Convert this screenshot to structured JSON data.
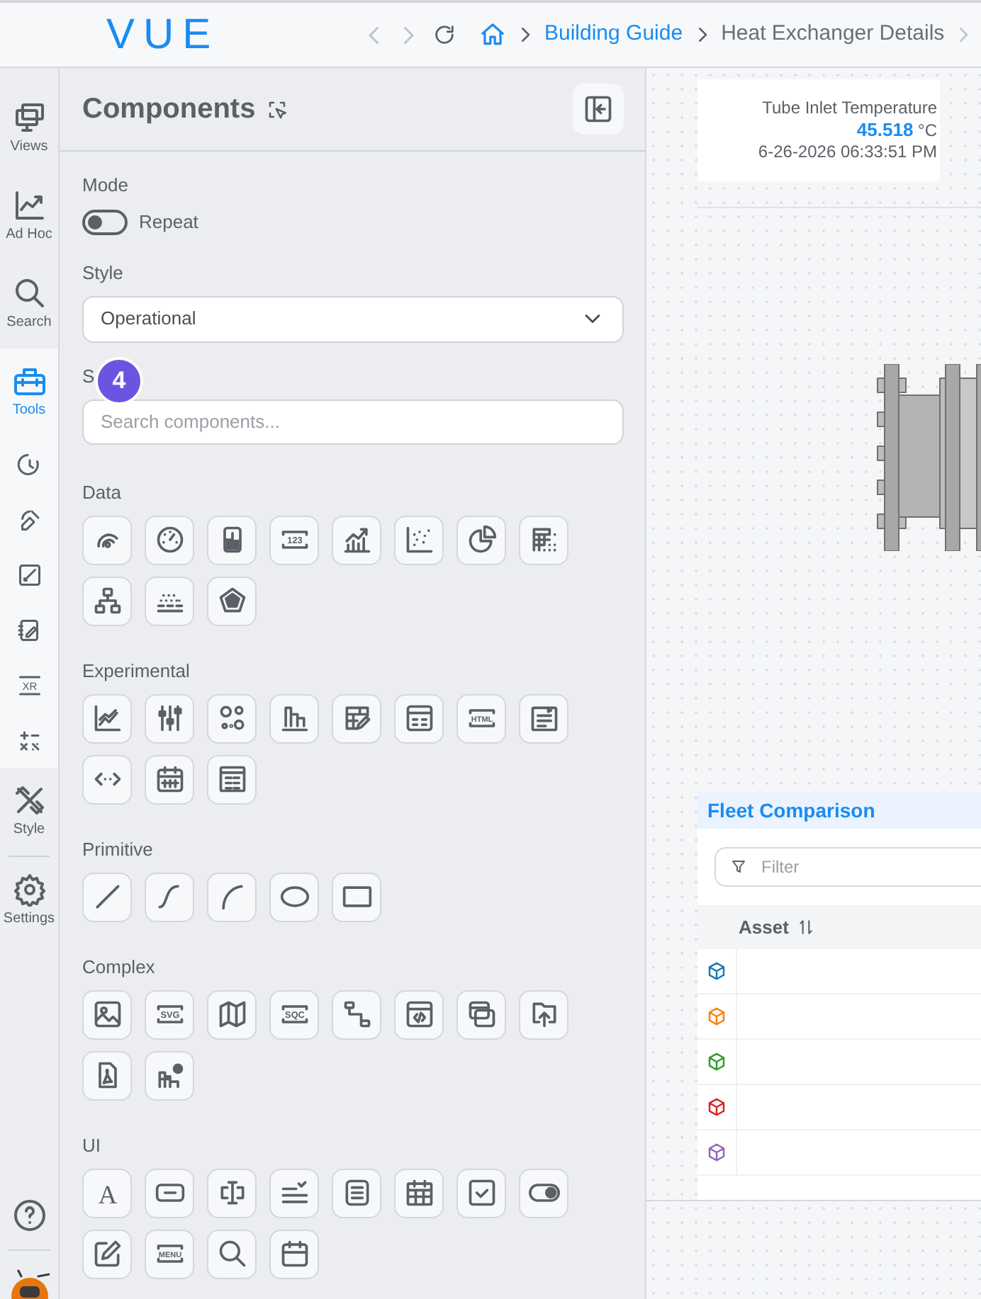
{
  "header": {
    "logo": "VUE",
    "breadcrumbs": [
      {
        "label": "Building Guide",
        "kind": "link"
      },
      {
        "label": "Heat Exchanger Details",
        "kind": "current"
      }
    ]
  },
  "nav": {
    "items": [
      {
        "kind": "views",
        "label": "Views",
        "selected": false
      },
      {
        "kind": "adhoc",
        "label": "Ad Hoc",
        "selected": false
      },
      {
        "kind": "search",
        "label": "Search",
        "selected": false
      },
      {
        "kind": "tools",
        "label": "Tools",
        "selected": true,
        "children": [
          {
            "kind": "timer"
          },
          {
            "kind": "pen"
          },
          {
            "kind": "image-edit"
          },
          {
            "kind": "notebook"
          },
          {
            "kind": "xr",
            "label": "XR"
          },
          {
            "kind": "math"
          }
        ]
      },
      {
        "kind": "style",
        "label": "Style",
        "selected": false
      },
      {
        "kind": "settings",
        "label": "Settings",
        "selected": false
      }
    ]
  },
  "panel": {
    "title": "Components",
    "mode": {
      "label": "Mode",
      "toggle_label": "Repeat",
      "on": false
    },
    "style": {
      "label": "Style",
      "value": "Operational"
    },
    "search": {
      "label": "S",
      "badge": "4",
      "placeholder": "Search components..."
    },
    "sections": [
      {
        "title": "Data",
        "tiles": [
          {
            "kind": "arcs"
          },
          {
            "kind": "gauge"
          },
          {
            "kind": "tank"
          },
          {
            "kind": "tag",
            "label": "123"
          },
          {
            "kind": "line-bars"
          },
          {
            "kind": "scatter"
          },
          {
            "kind": "pie"
          },
          {
            "kind": "grid"
          },
          {
            "kind": "hierarchy"
          },
          {
            "kind": "dotted-lines"
          },
          {
            "kind": "pentagon"
          }
        ]
      },
      {
        "title": "Experimental",
        "tiles": [
          {
            "kind": "area-chart"
          },
          {
            "kind": "sliders"
          },
          {
            "kind": "circles"
          },
          {
            "kind": "bar-chart"
          },
          {
            "kind": "table-pen"
          },
          {
            "kind": "form-window"
          },
          {
            "kind": "tag",
            "label": "HTML"
          },
          {
            "kind": "document"
          },
          {
            "kind": "code-arrows"
          },
          {
            "kind": "calendar-grid"
          },
          {
            "kind": "spreadsheet"
          }
        ]
      },
      {
        "title": "Primitive",
        "tiles": [
          {
            "kind": "line"
          },
          {
            "kind": "s-curve"
          },
          {
            "kind": "arc"
          },
          {
            "kind": "ellipse"
          },
          {
            "kind": "rectangle"
          }
        ]
      },
      {
        "title": "Complex",
        "tiles": [
          {
            "kind": "image"
          },
          {
            "kind": "tag",
            "label": "SVG"
          },
          {
            "kind": "map"
          },
          {
            "kind": "tag",
            "label": "SQC"
          },
          {
            "kind": "flow"
          },
          {
            "kind": "code-window"
          },
          {
            "kind": "windows"
          },
          {
            "kind": "upload"
          },
          {
            "kind": "pdf"
          },
          {
            "kind": "bars-check"
          }
        ]
      },
      {
        "title": "UI",
        "tiles": [
          {
            "kind": "letter",
            "label": "A"
          },
          {
            "kind": "input"
          },
          {
            "kind": "text-cursor"
          },
          {
            "kind": "list-check"
          },
          {
            "kind": "list-doc"
          },
          {
            "kind": "calendar"
          },
          {
            "kind": "checkbox"
          },
          {
            "kind": "toggle"
          },
          {
            "kind": "edit"
          },
          {
            "kind": "tag",
            "label": "MENU"
          },
          {
            "kind": "search"
          },
          {
            "kind": "calendar-blank"
          }
        ]
      }
    ]
  },
  "canvas": {
    "reading": {
      "title": "Tube Inlet Temperature",
      "value": "45.518",
      "unit": "°C",
      "timestamp": "6-26-2026 06:33:51 PM"
    },
    "fleet": {
      "title": "Fleet Comparison",
      "filter_placeholder": "Filter",
      "columns": [
        "Asset"
      ],
      "rows": [
        {
          "color": "#1f77b4"
        },
        {
          "color": "#ff7f0e"
        },
        {
          "color": "#2ca02c"
        },
        {
          "color": "#d62728"
        },
        {
          "color": "#9467bd"
        }
      ]
    }
  }
}
